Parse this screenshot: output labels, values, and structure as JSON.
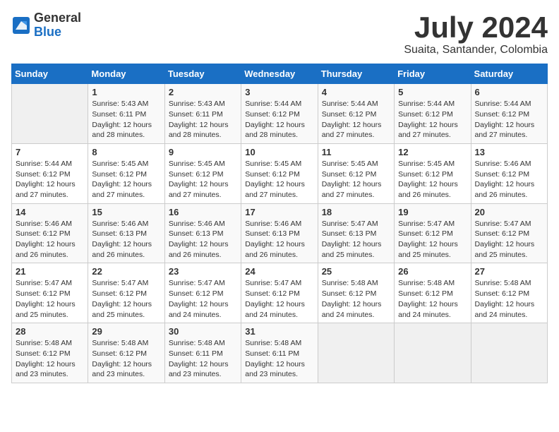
{
  "logo": {
    "general": "General",
    "blue": "Blue"
  },
  "header": {
    "month": "July 2024",
    "location": "Suaita, Santander, Colombia"
  },
  "weekdays": [
    "Sunday",
    "Monday",
    "Tuesday",
    "Wednesday",
    "Thursday",
    "Friday",
    "Saturday"
  ],
  "weeks": [
    [
      {
        "day": "",
        "empty": true
      },
      {
        "day": "1",
        "sunrise": "Sunrise: 5:43 AM",
        "sunset": "Sunset: 6:11 PM",
        "daylight": "Daylight: 12 hours and 28 minutes."
      },
      {
        "day": "2",
        "sunrise": "Sunrise: 5:43 AM",
        "sunset": "Sunset: 6:11 PM",
        "daylight": "Daylight: 12 hours and 28 minutes."
      },
      {
        "day": "3",
        "sunrise": "Sunrise: 5:44 AM",
        "sunset": "Sunset: 6:12 PM",
        "daylight": "Daylight: 12 hours and 28 minutes."
      },
      {
        "day": "4",
        "sunrise": "Sunrise: 5:44 AM",
        "sunset": "Sunset: 6:12 PM",
        "daylight": "Daylight: 12 hours and 27 minutes."
      },
      {
        "day": "5",
        "sunrise": "Sunrise: 5:44 AM",
        "sunset": "Sunset: 6:12 PM",
        "daylight": "Daylight: 12 hours and 27 minutes."
      },
      {
        "day": "6",
        "sunrise": "Sunrise: 5:44 AM",
        "sunset": "Sunset: 6:12 PM",
        "daylight": "Daylight: 12 hours and 27 minutes."
      }
    ],
    [
      {
        "day": "7",
        "sunrise": "Sunrise: 5:44 AM",
        "sunset": "Sunset: 6:12 PM",
        "daylight": "Daylight: 12 hours and 27 minutes."
      },
      {
        "day": "8",
        "sunrise": "Sunrise: 5:45 AM",
        "sunset": "Sunset: 6:12 PM",
        "daylight": "Daylight: 12 hours and 27 minutes."
      },
      {
        "day": "9",
        "sunrise": "Sunrise: 5:45 AM",
        "sunset": "Sunset: 6:12 PM",
        "daylight": "Daylight: 12 hours and 27 minutes."
      },
      {
        "day": "10",
        "sunrise": "Sunrise: 5:45 AM",
        "sunset": "Sunset: 6:12 PM",
        "daylight": "Daylight: 12 hours and 27 minutes."
      },
      {
        "day": "11",
        "sunrise": "Sunrise: 5:45 AM",
        "sunset": "Sunset: 6:12 PM",
        "daylight": "Daylight: 12 hours and 27 minutes."
      },
      {
        "day": "12",
        "sunrise": "Sunrise: 5:45 AM",
        "sunset": "Sunset: 6:12 PM",
        "daylight": "Daylight: 12 hours and 26 minutes."
      },
      {
        "day": "13",
        "sunrise": "Sunrise: 5:46 AM",
        "sunset": "Sunset: 6:12 PM",
        "daylight": "Daylight: 12 hours and 26 minutes."
      }
    ],
    [
      {
        "day": "14",
        "sunrise": "Sunrise: 5:46 AM",
        "sunset": "Sunset: 6:12 PM",
        "daylight": "Daylight: 12 hours and 26 minutes."
      },
      {
        "day": "15",
        "sunrise": "Sunrise: 5:46 AM",
        "sunset": "Sunset: 6:13 PM",
        "daylight": "Daylight: 12 hours and 26 minutes."
      },
      {
        "day": "16",
        "sunrise": "Sunrise: 5:46 AM",
        "sunset": "Sunset: 6:13 PM",
        "daylight": "Daylight: 12 hours and 26 minutes."
      },
      {
        "day": "17",
        "sunrise": "Sunrise: 5:46 AM",
        "sunset": "Sunset: 6:13 PM",
        "daylight": "Daylight: 12 hours and 26 minutes."
      },
      {
        "day": "18",
        "sunrise": "Sunrise: 5:47 AM",
        "sunset": "Sunset: 6:13 PM",
        "daylight": "Daylight: 12 hours and 25 minutes."
      },
      {
        "day": "19",
        "sunrise": "Sunrise: 5:47 AM",
        "sunset": "Sunset: 6:12 PM",
        "daylight": "Daylight: 12 hours and 25 minutes."
      },
      {
        "day": "20",
        "sunrise": "Sunrise: 5:47 AM",
        "sunset": "Sunset: 6:12 PM",
        "daylight": "Daylight: 12 hours and 25 minutes."
      }
    ],
    [
      {
        "day": "21",
        "sunrise": "Sunrise: 5:47 AM",
        "sunset": "Sunset: 6:12 PM",
        "daylight": "Daylight: 12 hours and 25 minutes."
      },
      {
        "day": "22",
        "sunrise": "Sunrise: 5:47 AM",
        "sunset": "Sunset: 6:12 PM",
        "daylight": "Daylight: 12 hours and 25 minutes."
      },
      {
        "day": "23",
        "sunrise": "Sunrise: 5:47 AM",
        "sunset": "Sunset: 6:12 PM",
        "daylight": "Daylight: 12 hours and 24 minutes."
      },
      {
        "day": "24",
        "sunrise": "Sunrise: 5:47 AM",
        "sunset": "Sunset: 6:12 PM",
        "daylight": "Daylight: 12 hours and 24 minutes."
      },
      {
        "day": "25",
        "sunrise": "Sunrise: 5:48 AM",
        "sunset": "Sunset: 6:12 PM",
        "daylight": "Daylight: 12 hours and 24 minutes."
      },
      {
        "day": "26",
        "sunrise": "Sunrise: 5:48 AM",
        "sunset": "Sunset: 6:12 PM",
        "daylight": "Daylight: 12 hours and 24 minutes."
      },
      {
        "day": "27",
        "sunrise": "Sunrise: 5:48 AM",
        "sunset": "Sunset: 6:12 PM",
        "daylight": "Daylight: 12 hours and 24 minutes."
      }
    ],
    [
      {
        "day": "28",
        "sunrise": "Sunrise: 5:48 AM",
        "sunset": "Sunset: 6:12 PM",
        "daylight": "Daylight: 12 hours and 23 minutes."
      },
      {
        "day": "29",
        "sunrise": "Sunrise: 5:48 AM",
        "sunset": "Sunset: 6:12 PM",
        "daylight": "Daylight: 12 hours and 23 minutes."
      },
      {
        "day": "30",
        "sunrise": "Sunrise: 5:48 AM",
        "sunset": "Sunset: 6:11 PM",
        "daylight": "Daylight: 12 hours and 23 minutes."
      },
      {
        "day": "31",
        "sunrise": "Sunrise: 5:48 AM",
        "sunset": "Sunset: 6:11 PM",
        "daylight": "Daylight: 12 hours and 23 minutes."
      },
      {
        "day": "",
        "empty": true
      },
      {
        "day": "",
        "empty": true
      },
      {
        "day": "",
        "empty": true
      }
    ]
  ]
}
